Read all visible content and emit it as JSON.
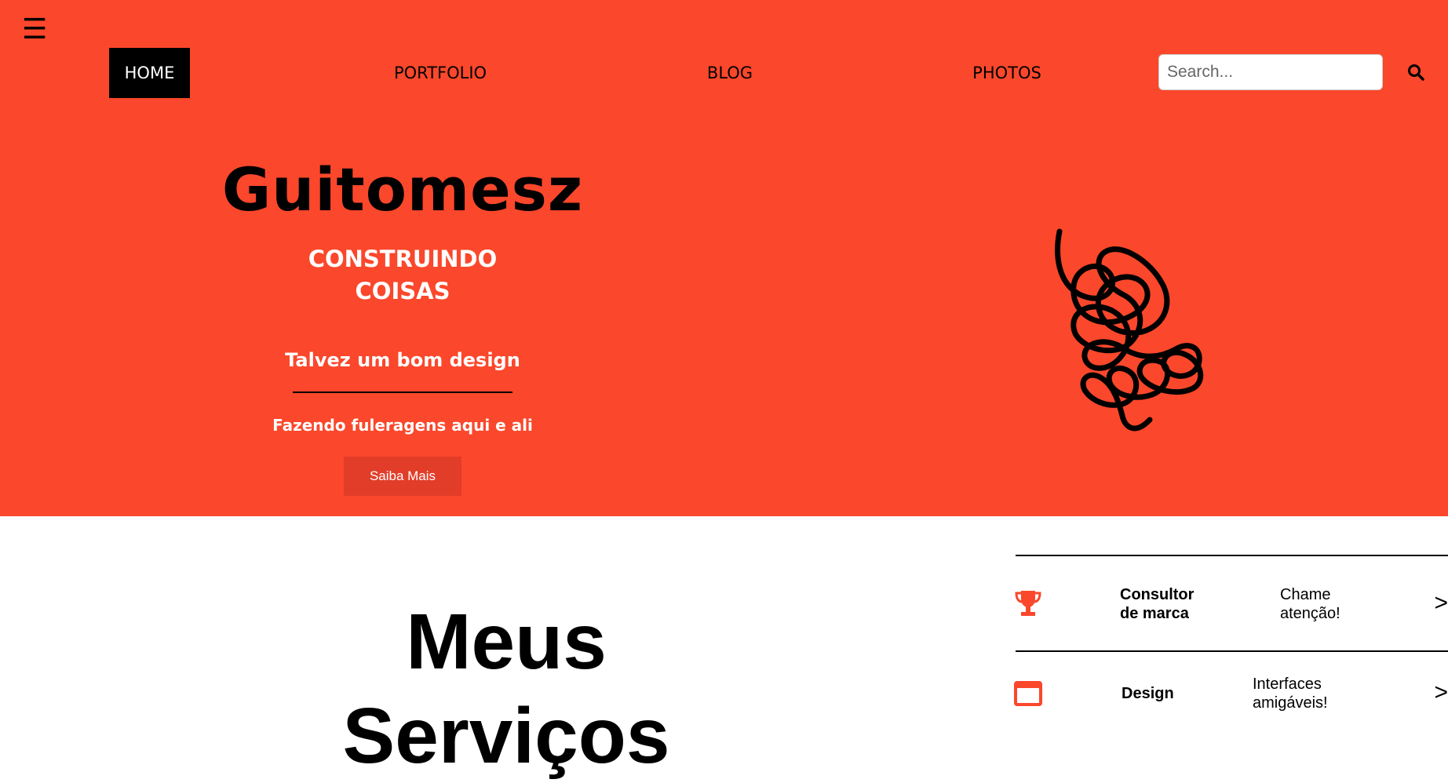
{
  "nav": {
    "menu_icon": "☰",
    "items": [
      {
        "label": "HOME",
        "active": true
      },
      {
        "label": "PORTFOLIO"
      },
      {
        "label": "BLOG"
      },
      {
        "label": "PHOTOS"
      }
    ],
    "search_placeholder": "Search...",
    "search_icon": "search-icon"
  },
  "hero": {
    "title": "Guitomesz",
    "subtitle_line1": "CONSTRUINDO",
    "subtitle_line2": "COISAS",
    "tagline": "Talvez um bom design",
    "description": "Fazendo fuleragens aqui e ali",
    "cta_label": "Saiba Mais"
  },
  "section": {
    "title_line1": "Meus",
    "title_line2": "Serviços"
  },
  "services": [
    {
      "icon": "trophy-icon",
      "name_line1": "Consultor",
      "name_line2": "de marca",
      "desc_line1": "Chame",
      "desc_line2": "atenção!",
      "arrow": ">"
    },
    {
      "icon": "browser-window-icon",
      "name_line1": "Design",
      "name_line2": "",
      "desc_line1": "Interfaces",
      "desc_line2": "amigáveis!",
      "arrow": ">"
    }
  ],
  "colors": {
    "hero_bg": "#fb472b",
    "cta_bg": "#e23d29",
    "accent_icon": "#fb472b"
  }
}
